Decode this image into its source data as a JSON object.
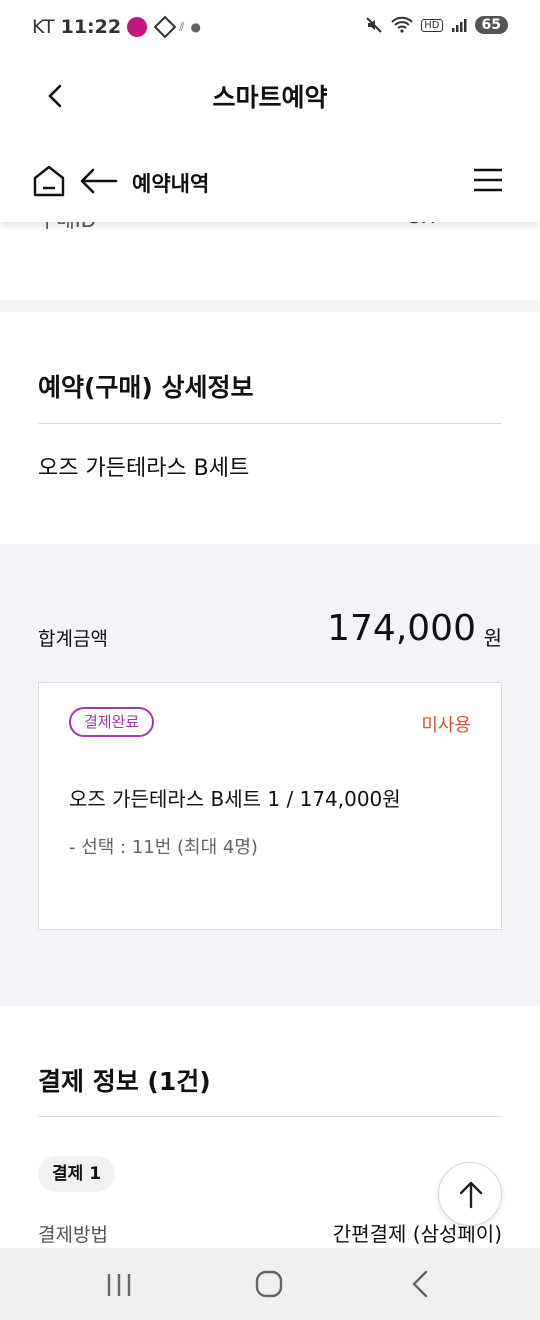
{
  "status_bar": {
    "carrier": "KT",
    "time": "11:22",
    "battery": "65",
    "network": "HD"
  },
  "header": {
    "title": "스마트예약"
  },
  "subnav": {
    "title": "예약내역"
  },
  "partial_row": {
    "label": "구매ID",
    "value": "SH"
  },
  "detail": {
    "heading": "예약(구매) 상세정보",
    "item_name": "오즈 가든테라스 B세트"
  },
  "summary": {
    "total_label": "합계금액",
    "total_amount": "174,000",
    "currency_unit": "원",
    "status_badge": "결제완료",
    "usage_status": "미사용",
    "order_line": "오즈 가든테라스 B세트 1 / 174,000원",
    "option_line": "- 선택 : 11번 (최대 4명)"
  },
  "payment": {
    "heading": "결제 정보 (1건)",
    "chip": "결제 1",
    "method_label": "결제방법",
    "method_value": "간편결제 (삼성페이)"
  },
  "colors": {
    "badge": "#a33aa6",
    "unused": "#e0532f",
    "page_bg": "#f2f4f8"
  }
}
